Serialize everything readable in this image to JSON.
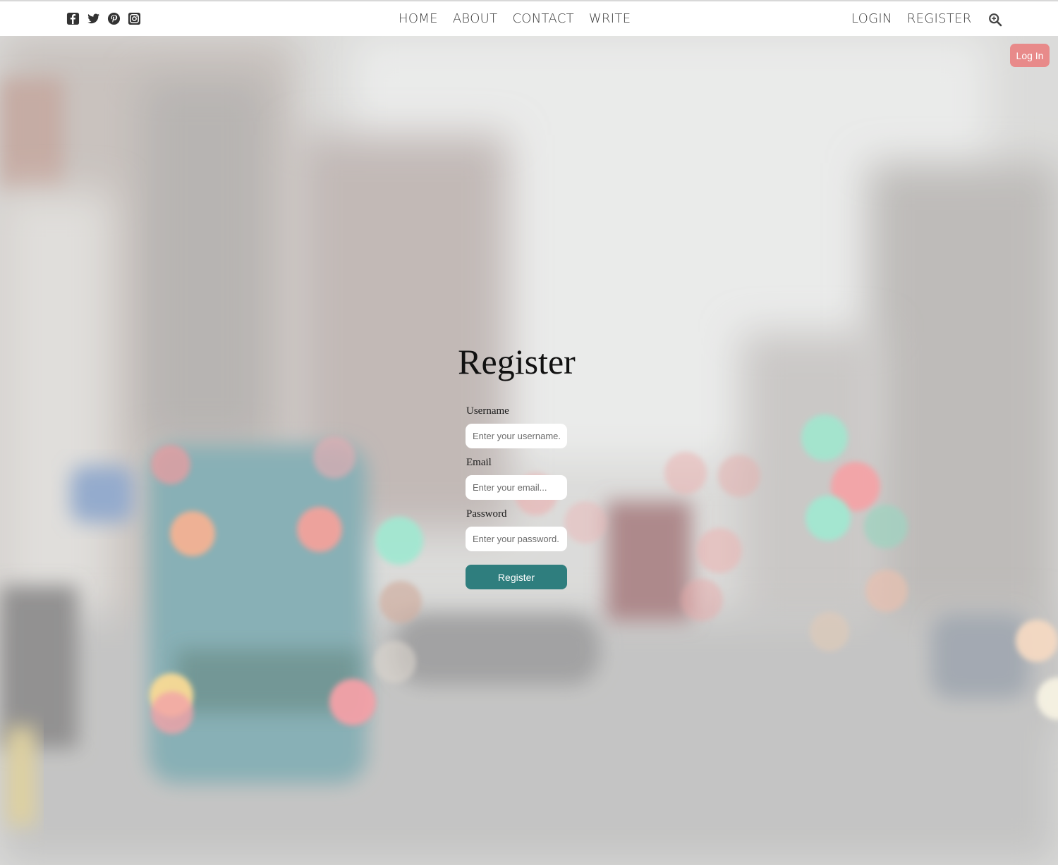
{
  "header": {
    "social_icons": [
      "facebook-square-icon",
      "twitter-icon",
      "pinterest-icon",
      "instagram-icon"
    ],
    "nav_center": [
      "HOME",
      "ABOUT",
      "CONTACT",
      "WRITE"
    ],
    "nav_right": [
      "LOGIN",
      "REGISTER"
    ],
    "search_icon": "search-icon"
  },
  "corner_button": {
    "label": "Log In",
    "color": "#e88a8a"
  },
  "register": {
    "title": "Register",
    "username_label": "Username",
    "username_placeholder": "Enter your username...",
    "email_label": "Email",
    "email_placeholder": "Enter your email...",
    "password_label": "Password",
    "password_placeholder": "Enter your password...",
    "submit_label": "Register",
    "submit_color": "#2f7e7e"
  }
}
